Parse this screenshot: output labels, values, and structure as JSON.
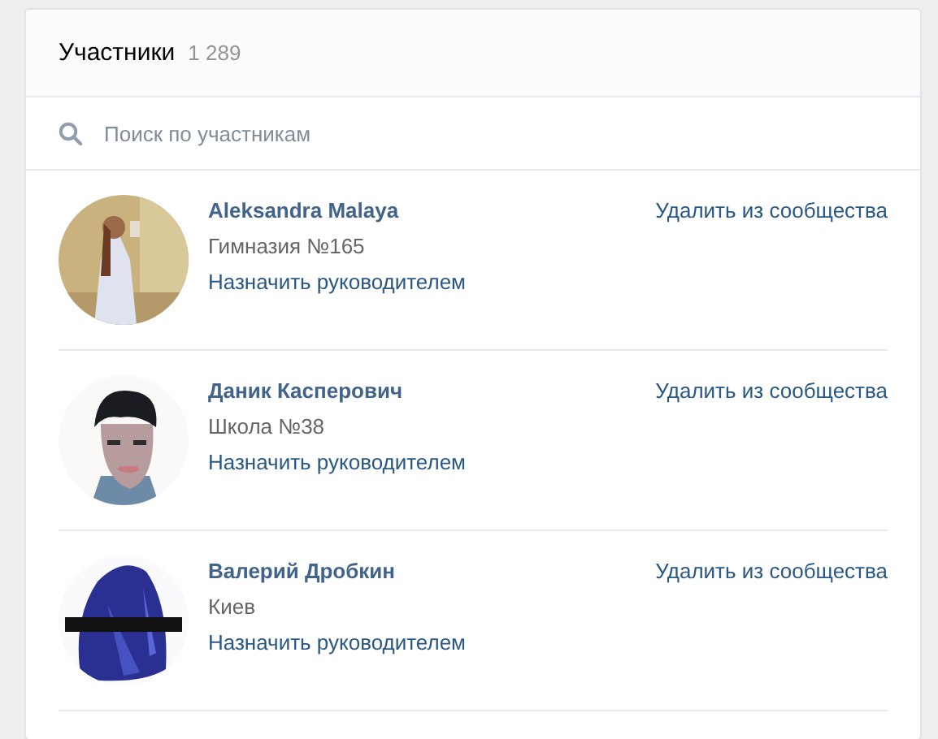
{
  "header": {
    "title": "Участники",
    "count": "1 289"
  },
  "search": {
    "placeholder": "Поиск по участникам"
  },
  "members": [
    {
      "name": "Aleksandra Malaya",
      "info": "Гимназия №165",
      "action": "Назначить руководителем",
      "remove": "Удалить из сообщества"
    },
    {
      "name": "Даник Касперович",
      "info": "Школа №38",
      "action": "Назначить руководителем",
      "remove": "Удалить из сообщества"
    },
    {
      "name": "Валерий Дробкин",
      "info": "Киев",
      "action": "Назначить руководителем",
      "remove": "Удалить из сообщества"
    }
  ]
}
